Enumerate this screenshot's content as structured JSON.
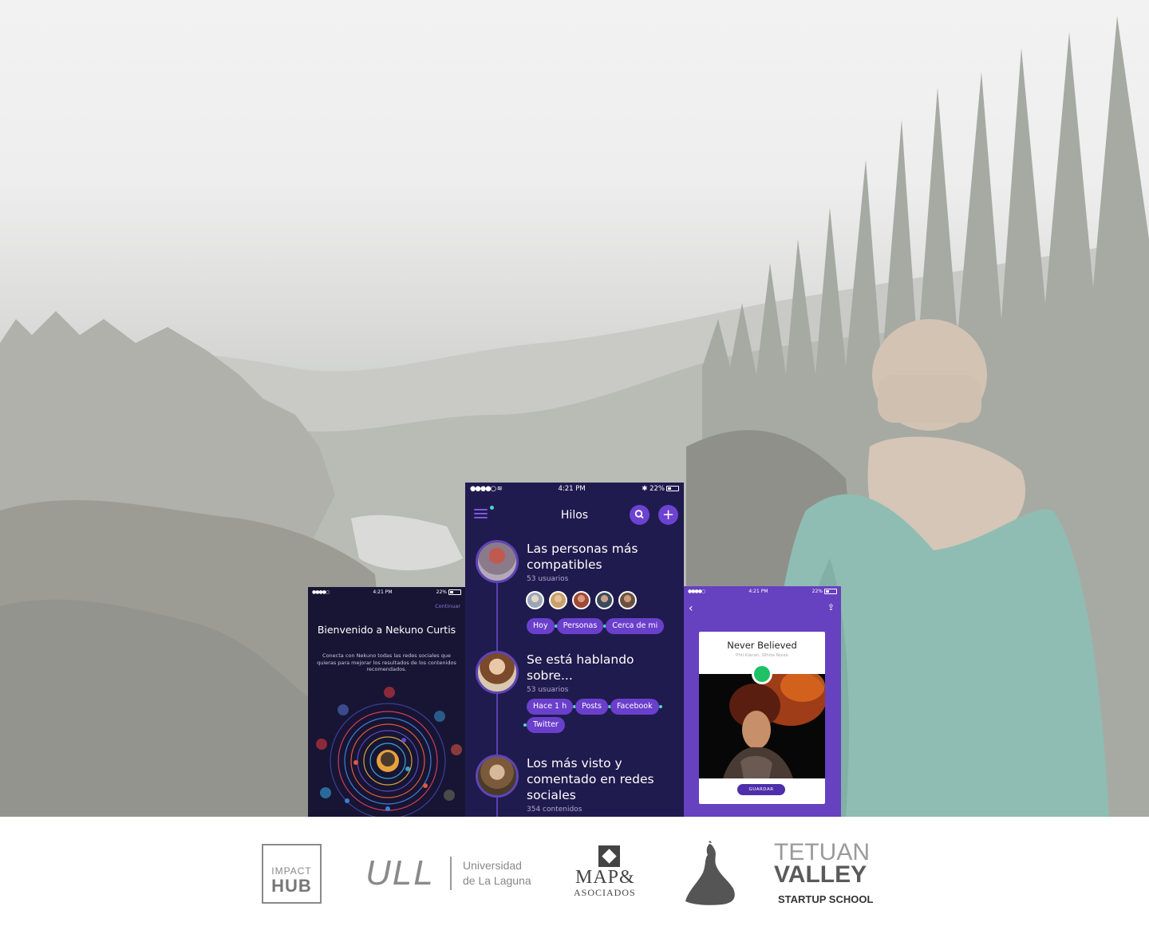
{
  "colors": {
    "phone_dark_bg": "#1f1b4e",
    "phone_accent": "#6a3fcc",
    "teal_dot": "#4fd6c6",
    "right_phone_bg": "#6641c0",
    "spotify_green": "#1ec164"
  },
  "left_phone": {
    "status_time": "4:21 PM",
    "status_battery": "22%",
    "continue_label": "Continuar",
    "welcome_title": "Bienvenido a Nekuno Curtis",
    "description": "Conecta con Nekuno todas las redes sociales que quieras para mejorar los resultados de los contenidos recomendados.",
    "social_icons": [
      "youtube-icon",
      "facebook-icon",
      "linkedin-icon",
      "pinterest-icon",
      "google-plus-icon",
      "twitter-icon",
      "stack-icon"
    ]
  },
  "middle_phone": {
    "status_time": "4:21 PM",
    "status_battery": "22%",
    "nav_title": "Hilos",
    "threads": [
      {
        "title": "Las personas más compatibles",
        "subtitle": "53 usuarios",
        "chips": [
          "Hoy",
          "Personas",
          "Cerca de mi"
        ]
      },
      {
        "title": "Se está hablando sobre...",
        "subtitle": "53 usuarios",
        "chips": [
          "Hace 1 h",
          "Posts",
          "Facebook",
          "Twitter"
        ]
      },
      {
        "title": "Los más visto y comentado en redes sociales",
        "subtitle": "354 contenidos",
        "chips": []
      }
    ]
  },
  "right_phone": {
    "status_time": "4:21 PM",
    "status_battery": "22%",
    "card_title": "Never Believed",
    "card_subtitle": "Phil Kieran, White Noise",
    "save_label": "GUARDAR"
  },
  "partners": {
    "impact_line1": "IMPACT",
    "impact_line2": "HUB",
    "ull_mark": "ULL",
    "ull_line1": "Universidad",
    "ull_line2": "de La Laguna",
    "map_line1": "MAP&",
    "map_line2": "ASOCIADOS",
    "tetuan_line1": "TETUAN",
    "tetuan_line2": "VALLEY",
    "tetuan_line3": "STARTUP SCHOOL"
  }
}
